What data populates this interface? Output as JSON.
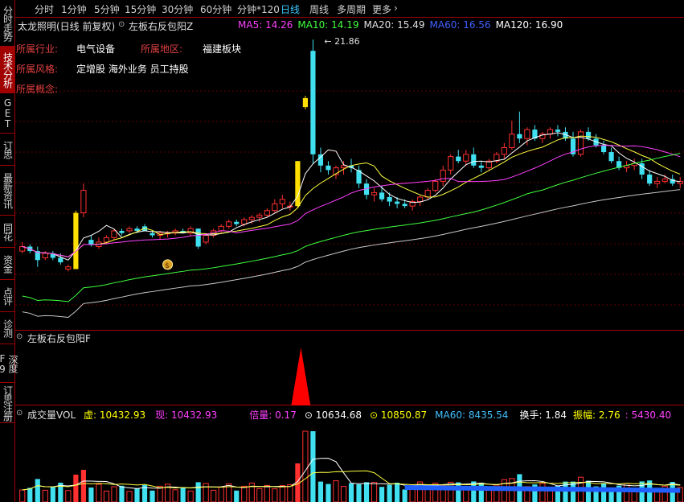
{
  "sidebar": {
    "tabs": [
      {
        "label": "分时走势",
        "active": false
      },
      {
        "label": "技术分析",
        "active": true
      },
      {
        "label": "GET",
        "active": false
      },
      {
        "label": "订思",
        "active": false
      },
      {
        "label": "最新资讯",
        "active": false
      },
      {
        "label": "同花",
        "active": false
      },
      {
        "label": "资金",
        "active": false
      },
      {
        "label": "点评",
        "active": false
      },
      {
        "label": "诊测",
        "active": false
      },
      {
        "label": "深度F9",
        "active": false
      },
      {
        "label": "订思注册",
        "active": false
      }
    ]
  },
  "toolbar": {
    "periods": [
      "分时",
      "1分钟",
      "5分钟",
      "15分钟",
      "30分钟",
      "60分钟",
      "分钟*120",
      "日线",
      "周线",
      "多周期",
      "更多"
    ],
    "active": "日线",
    "more_icon": "chevron-right-icon"
  },
  "main_panel": {
    "stock_title": "太龙照明(日线 前复权)",
    "indicator_name": "左板右反包阳Z",
    "ma": [
      {
        "label": "MA5:",
        "value": "14.26",
        "color": "#ff40ff"
      },
      {
        "label": "MA10:",
        "value": "14.19",
        "color": "#40ff40"
      },
      {
        "label": "MA20:",
        "value": "15.49",
        "color": "#e0e0e0"
      },
      {
        "label": "MA60:",
        "value": "16.56",
        "color": "#4060ff"
      },
      {
        "label": "MA120:",
        "value": "16.90",
        "color": "#ffffff"
      }
    ],
    "info": [
      {
        "key": "所属行业:",
        "value": "电气设备"
      },
      {
        "key": "所属地区:",
        "value": "福建板块"
      },
      {
        "key": "所属风格:",
        "value": "定增股 海外业务 员工持股"
      },
      {
        "key": "所属概念:",
        "value": ""
      }
    ],
    "high_label": "21.86",
    "marker_icon": "money-bag-icon"
  },
  "indicator_panel": {
    "name": "左板右反包阳F"
  },
  "volume_panel": {
    "name": "成交量VOL",
    "stats": [
      {
        "label": "虚:",
        "value": "10432.93",
        "label_color": "#ffff00",
        "value_color": "#ffff00"
      },
      {
        "label": "现:",
        "value": "10432.93",
        "label_color": "#ff40ff",
        "value_color": "#ff40ff"
      },
      {
        "label": "倍量:",
        "value": "0.17",
        "label_color": "#ff40ff",
        "value_color": "#ff40ff"
      },
      {
        "label": "",
        "value": "10634.68",
        "label_color": "#ffffff",
        "value_color": "#ffffff"
      },
      {
        "label": "",
        "value": "10850.87",
        "label_color": "#ffff00",
        "value_color": "#ffff00"
      },
      {
        "label": "MA60:",
        "value": "8435.54",
        "label_color": "#40c0ff",
        "value_color": "#40c0ff"
      },
      {
        "label": "换手:",
        "value": "1.84",
        "label_color": "#ffffff",
        "value_color": "#ffffff"
      },
      {
        "label": "振幅:",
        "value": "2.76",
        "label_color": "#ffff00",
        "value_color": "#ffff00"
      },
      {
        "label": "",
        "value": ": 5430.40",
        "label_color": "#ff40ff",
        "value_color": "#ff40ff"
      }
    ]
  },
  "chart_data": {
    "type": "candlestick",
    "ylim": [
      9.5,
      22.8
    ],
    "candles": [
      [
        13.0,
        13.4,
        12.9,
        13.2
      ],
      [
        13.2,
        13.3,
        12.9,
        13.0
      ],
      [
        13.0,
        13.2,
        12.3,
        12.6
      ],
      [
        12.7,
        13.0,
        12.6,
        12.9
      ],
      [
        12.9,
        13.0,
        12.6,
        12.7
      ],
      [
        12.7,
        12.9,
        12.4,
        12.5
      ],
      [
        12.2,
        12.4,
        12.1,
        12.3
      ],
      [
        12.2,
        14.8,
        12.2,
        14.7
      ],
      [
        14.7,
        16.0,
        14.5,
        15.7
      ],
      [
        13.5,
        13.7,
        13.2,
        13.3
      ],
      [
        13.2,
        13.6,
        13.1,
        13.4
      ],
      [
        13.4,
        13.7,
        13.3,
        13.6
      ],
      [
        13.6,
        14.0,
        13.5,
        13.9
      ],
      [
        13.9,
        14.0,
        13.7,
        13.8
      ],
      [
        13.9,
        14.1,
        13.8,
        14.0
      ],
      [
        14.0,
        14.1,
        13.8,
        13.9
      ],
      [
        14.1,
        14.2,
        13.9,
        13.9
      ],
      [
        13.8,
        13.9,
        13.6,
        13.7
      ],
      [
        13.7,
        13.9,
        13.5,
        13.8
      ],
      [
        13.8,
        13.9,
        13.6,
        13.8
      ],
      [
        13.8,
        14.0,
        13.7,
        13.9
      ],
      [
        13.9,
        14.0,
        13.8,
        13.8
      ],
      [
        13.8,
        14.1,
        13.7,
        14.0
      ],
      [
        14.0,
        14.0,
        13.1,
        13.2
      ],
      [
        13.4,
        13.8,
        13.3,
        13.7
      ],
      [
        13.7,
        14.0,
        13.6,
        13.9
      ],
      [
        13.9,
        14.2,
        13.8,
        14.1
      ],
      [
        14.1,
        14.4,
        14.0,
        14.3
      ],
      [
        14.3,
        14.4,
        14.1,
        14.2
      ],
      [
        14.2,
        14.5,
        14.1,
        14.4
      ],
      [
        14.4,
        14.6,
        14.2,
        14.5
      ],
      [
        14.5,
        14.7,
        14.3,
        14.6
      ],
      [
        14.6,
        14.9,
        14.5,
        14.8
      ],
      [
        14.8,
        15.3,
        14.7,
        15.1
      ],
      [
        15.1,
        15.5,
        14.9,
        15.3
      ],
      [
        15.0,
        15.2,
        14.8,
        15.0
      ],
      [
        15.0,
        17.0,
        14.9,
        17.0
      ],
      [
        19.4,
        19.9,
        19.3,
        19.8
      ],
      [
        21.9,
        22.4,
        16.9,
        17.3
      ],
      [
        17.3,
        17.6,
        16.5,
        16.8
      ],
      [
        16.8,
        17.0,
        16.4,
        16.6
      ],
      [
        16.4,
        16.8,
        16.2,
        16.7
      ],
      [
        16.7,
        17.0,
        16.4,
        16.8
      ],
      [
        16.8,
        17.1,
        16.5,
        16.7
      ],
      [
        16.6,
        16.8,
        15.8,
        16.0
      ],
      [
        16.0,
        16.2,
        15.3,
        15.5
      ],
      [
        15.5,
        15.8,
        15.2,
        15.6
      ],
      [
        15.6,
        15.9,
        15.2,
        15.3
      ],
      [
        15.4,
        15.6,
        15.0,
        15.2
      ],
      [
        15.2,
        15.4,
        14.9,
        15.1
      ],
      [
        15.1,
        15.3,
        14.9,
        15.0
      ],
      [
        15.0,
        15.3,
        14.8,
        15.2
      ],
      [
        15.2,
        15.5,
        15.0,
        15.4
      ],
      [
        15.4,
        15.8,
        15.3,
        15.7
      ],
      [
        15.7,
        16.2,
        15.6,
        16.1
      ],
      [
        16.1,
        16.8,
        15.9,
        16.6
      ],
      [
        16.6,
        17.3,
        16.4,
        17.2
      ],
      [
        17.2,
        17.5,
        16.9,
        17.0
      ],
      [
        17.0,
        17.5,
        16.8,
        17.3
      ],
      [
        17.3,
        17.6,
        16.7,
        16.8
      ],
      [
        16.8,
        17.0,
        16.5,
        16.7
      ],
      [
        16.7,
        17.1,
        16.6,
        17.0
      ],
      [
        17.0,
        17.4,
        16.9,
        17.3
      ],
      [
        17.3,
        17.8,
        17.1,
        17.6
      ],
      [
        17.6,
        18.8,
        17.5,
        18.2
      ],
      [
        18.2,
        19.2,
        17.8,
        18.0
      ],
      [
        18.0,
        18.5,
        17.7,
        18.4
      ],
      [
        18.4,
        18.6,
        17.9,
        18.0
      ],
      [
        18.0,
        18.3,
        17.8,
        18.2
      ],
      [
        18.2,
        18.5,
        18.0,
        18.4
      ],
      [
        18.4,
        18.6,
        18.1,
        18.3
      ],
      [
        18.3,
        18.5,
        17.9,
        18.0
      ],
      [
        18.0,
        18.3,
        17.2,
        17.3
      ],
      [
        17.3,
        18.4,
        17.2,
        18.3
      ],
      [
        18.3,
        18.5,
        17.9,
        18.0
      ],
      [
        18.0,
        18.2,
        17.6,
        17.7
      ],
      [
        17.7,
        17.9,
        17.3,
        17.4
      ],
      [
        17.4,
        17.6,
        16.9,
        17.0
      ],
      [
        17.0,
        17.2,
        16.6,
        16.7
      ],
      [
        16.7,
        17.0,
        16.5,
        16.8
      ],
      [
        16.8,
        17.1,
        16.6,
        16.9
      ],
      [
        16.9,
        17.1,
        16.2,
        16.4
      ],
      [
        16.4,
        16.6,
        15.9,
        16.0
      ],
      [
        16.0,
        16.3,
        15.8,
        16.1
      ],
      [
        16.1,
        16.4,
        16.0,
        16.2
      ],
      [
        16.2,
        16.4,
        15.9,
        16.0
      ],
      [
        16.0,
        16.3,
        15.8,
        16.1
      ]
    ],
    "limit_up_days": [
      7,
      36,
      37
    ]
  }
}
